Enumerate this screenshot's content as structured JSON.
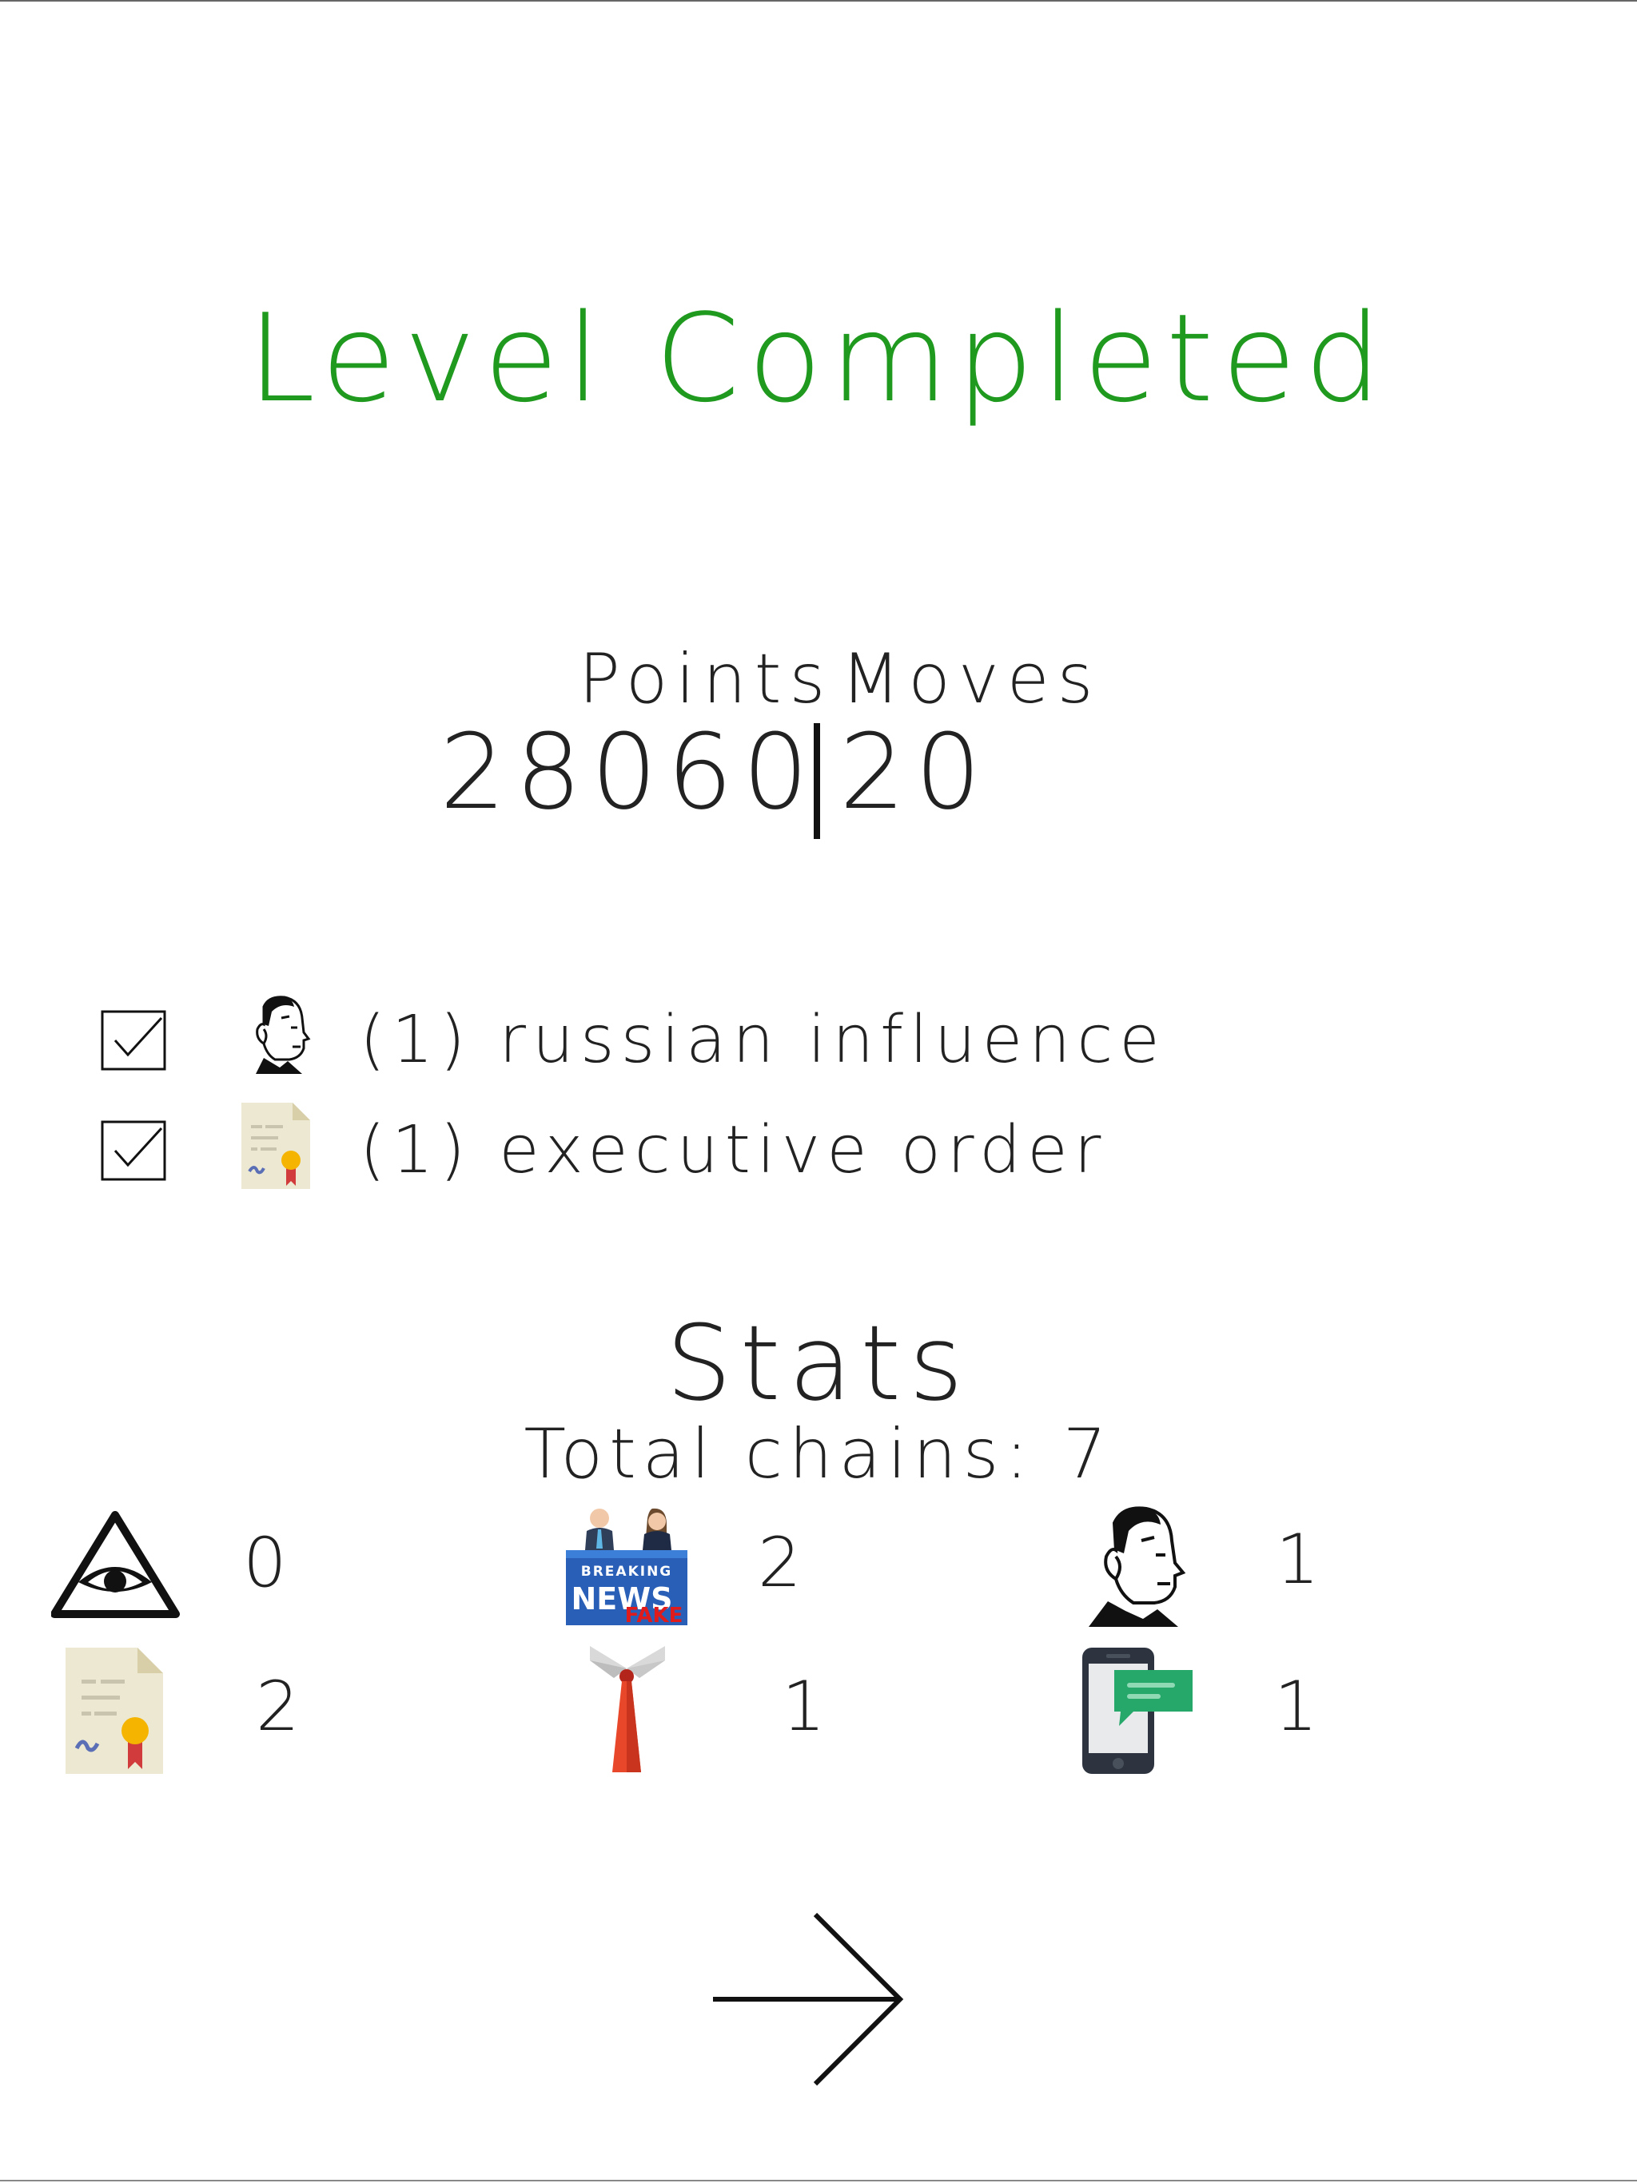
{
  "header": {
    "title": "Level Completed",
    "title_color": "#1f9a1f"
  },
  "score": {
    "points_label": "Points",
    "moves_label": "Moves",
    "points_value": "28060",
    "moves_value": "20"
  },
  "goals": [
    {
      "completed": true,
      "icon": "russian-influence-icon",
      "text": "(1) russian influence"
    },
    {
      "completed": true,
      "icon": "executive-order-icon",
      "text": "(1) executive order"
    }
  ],
  "stats": {
    "title": "Stats",
    "total_chains": "Total chains: 7",
    "items": [
      {
        "icon": "all-seeing-eye-icon",
        "value": "0"
      },
      {
        "icon": "fake-news-icon",
        "value": "2"
      },
      {
        "icon": "russian-influence-icon",
        "value": "1"
      },
      {
        "icon": "executive-order-icon",
        "value": "2"
      },
      {
        "icon": "red-tie-icon",
        "value": "1"
      },
      {
        "icon": "phone-message-icon",
        "value": "1"
      }
    ]
  },
  "navigation": {
    "next_icon": "arrow-right-icon"
  }
}
